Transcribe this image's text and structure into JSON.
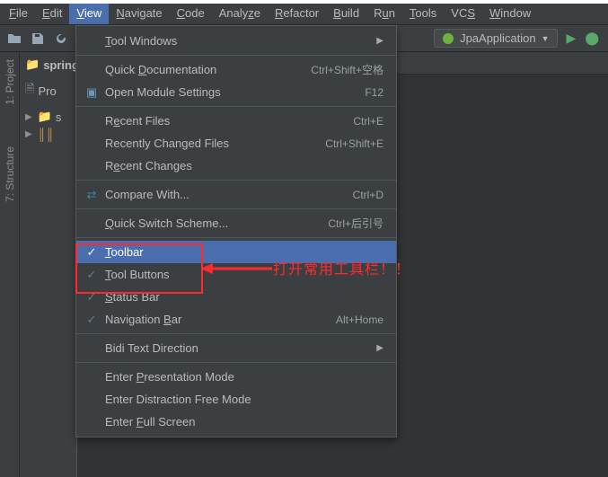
{
  "menubar": [
    {
      "letter": "F",
      "rest": "ile"
    },
    {
      "letter": "E",
      "rest": "dit"
    },
    {
      "letter": "V",
      "rest": "iew",
      "active": true
    },
    {
      "letter": "N",
      "rest": "avigate"
    },
    {
      "letter": "C",
      "rest": "ode"
    },
    {
      "letter": "",
      "rest": "Analyze",
      "u_index": 4
    },
    {
      "letter": "R",
      "rest": "efactor"
    },
    {
      "letter": "B",
      "rest": "uild"
    },
    {
      "letter": "",
      "rest": "Run",
      "u_index": 1
    },
    {
      "letter": "T",
      "rest": "ools"
    },
    {
      "letter": "",
      "rest": "VCS",
      "u_index": 2
    },
    {
      "letter": "W",
      "rest": "indow"
    }
  ],
  "toolbar": {
    "run_config_label": "JpaApplication"
  },
  "left_tabs": {
    "project": "1: Project",
    "structure": "7: Structure"
  },
  "project_tree": {
    "root": "spring",
    "tab": "Pro",
    "row_s": "s",
    "row_stats": ""
  },
  "view_menu": {
    "tool_windows": "Tool Windows",
    "quick_doc": {
      "label": "Quick Documentation",
      "sc": "Ctrl+Shift+空格"
    },
    "open_module": {
      "label": "Open Module Settings",
      "sc": "F12"
    },
    "recent_files": {
      "label": "Recent Files",
      "sc": "Ctrl+E"
    },
    "recently_changed_files": {
      "label": "Recently Changed Files",
      "sc": "Ctrl+Shift+E"
    },
    "recent_changes": {
      "label": "Recent Changes"
    },
    "compare_with": {
      "label": "Compare With...",
      "sc": "Ctrl+D"
    },
    "quick_switch": {
      "label": "Quick Switch Scheme...",
      "sc": "Ctrl+后引号"
    },
    "toolbar": {
      "label": "Toolbar",
      "letter": "T",
      "rest": "oolbar"
    },
    "tool_buttons": {
      "label": "Tool Buttons",
      "letter": "T",
      "rest": "ool Buttons"
    },
    "status_bar": {
      "label": "Status Bar",
      "letter": "S",
      "rest": "tatus Bar"
    },
    "nav_bar": {
      "label": "Navigation Bar",
      "letter_at": 11,
      "sc": "Alt+Home"
    },
    "bidi": {
      "label": "Bidi Text Direction"
    },
    "presentation": {
      "label": "Enter Presentation Mode"
    },
    "distraction": {
      "label": "Enter Distraction Free Mode"
    },
    "fullscreen": {
      "label": "Enter Full Screen"
    }
  },
  "annotation": "打开常用工具栏！！"
}
